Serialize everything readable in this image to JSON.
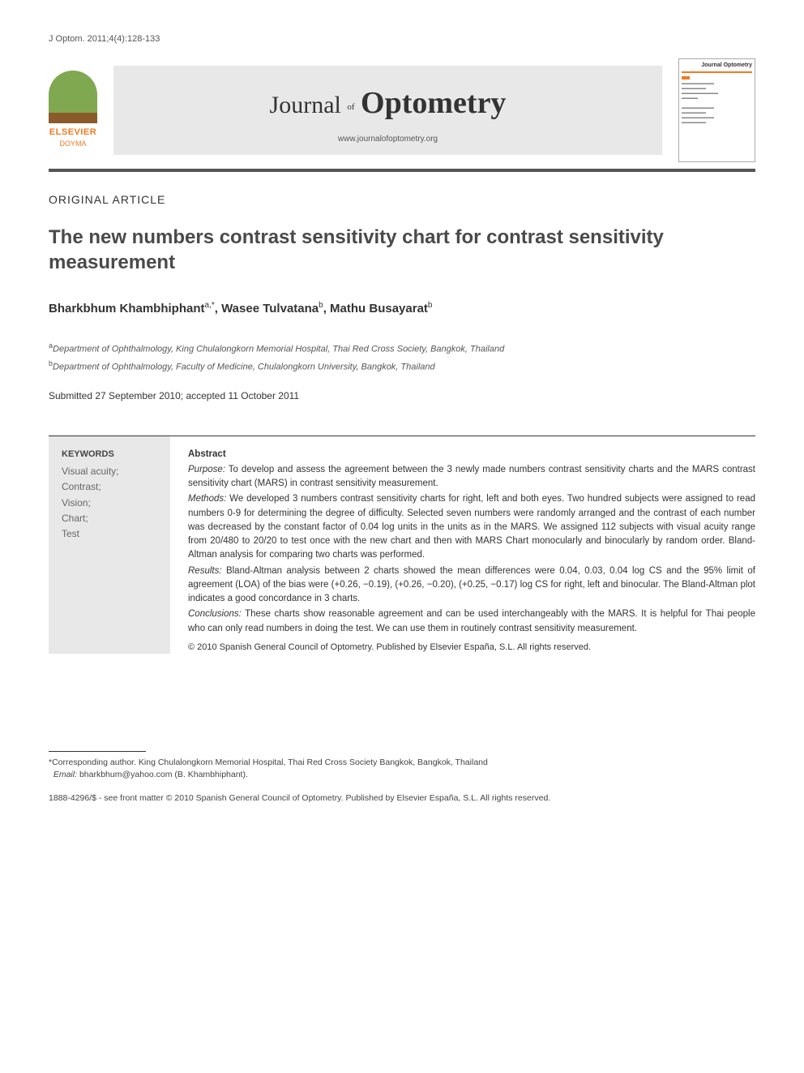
{
  "citation": "J Optom. 2011;4(4):128-133",
  "publisher": {
    "name": "ELSEVIER",
    "sub": "DOYMA"
  },
  "journal": {
    "prefix": "Journal",
    "of": "of",
    "main": "Optometry",
    "url": "www.journalofoptometry.org"
  },
  "cover": {
    "title": "Journal Optometry"
  },
  "article_type": "ORIGINAL ARTICLE",
  "title": "The new numbers contrast sensitivity chart for contrast sensitivity measurement",
  "authors_html": "Bharkbhum Khambhiphant",
  "author_sup1": "a,*",
  "author2": ", Wasee Tulvatana",
  "author_sup2": "b",
  "author3": ", Mathu Busayarat",
  "author_sup3": "b",
  "affiliations": {
    "a_sup": "a",
    "a": "Department of Ophthalmology, King Chulalongkorn Memorial Hospital, Thai Red Cross Society, Bangkok, Thailand",
    "b_sup": "b",
    "b": "Department of Ophthalmology, Faculty of Medicine, Chulalongkorn University, Bangkok, Thailand"
  },
  "dates": "Submitted 27 September 2010; accepted 11 October 2011",
  "keywords": {
    "heading": "KEYWORDS",
    "items": [
      "Visual acuity;",
      "Contrast;",
      "Vision;",
      "Chart;",
      "Test"
    ]
  },
  "abstract": {
    "heading": "Abstract",
    "purpose_label": "Purpose:",
    "purpose": " To develop and assess the agreement between the 3 newly made numbers contrast sensitivity charts and the MARS contrast sensitivity chart (MARS) in contrast sensitivity measurement.",
    "methods_label": "Methods:",
    "methods": " We developed 3 numbers contrast sensitivity charts for right, left and both eyes. Two hundred subjects were assigned to read numbers 0-9 for determining the degree of difficulty. Selected seven numbers were randomly arranged and the contrast of each number was decreased by the constant factor of 0.04 log units in the units as in the MARS. We assigned 112 subjects with visual acuity range from 20/480 to 20/20 to test once with the new chart and then with MARS Chart monocularly and binocularly by random order. Bland-Altman analysis for comparing two charts was performed.",
    "results_label": "Results:",
    "results": " Bland-Altman analysis between 2 charts showed the mean differences were 0.04, 0.03, 0.04 log CS and the 95% limit of agreement (LOA) of the bias were (+0.26, −0.19), (+0.26, −0.20), (+0.25, −0.17) log CS for right, left and binocular. The Bland-Altman plot indicates a good concordance in 3 charts.",
    "conclusions_label": "Conclusions:",
    "conclusions": " These charts show reasonable agreement and can be used interchangeably with the MARS. It is helpful for Thai people who can only read numbers in doing the test. We can use them in routinely contrast sensitivity measurement.",
    "copyright": "© 2010 Spanish General Council of Optometry. Published by Elsevier España, S.L. All rights reserved."
  },
  "footnote": {
    "marker": "*",
    "corresponding": "Corresponding author. King Chulalongkorn Memorial Hospital, Thai Red Cross Society Bangkok, Bangkok, Thailand",
    "email_label": "Email:",
    "email": " bharkbhum@yahoo.com (B. Khambhiphant)."
  },
  "front_matter": "1888-4296/$ - see front matter © 2010 Spanish General Council of Optometry. Published by Elsevier España, S.L. All rights reserved."
}
